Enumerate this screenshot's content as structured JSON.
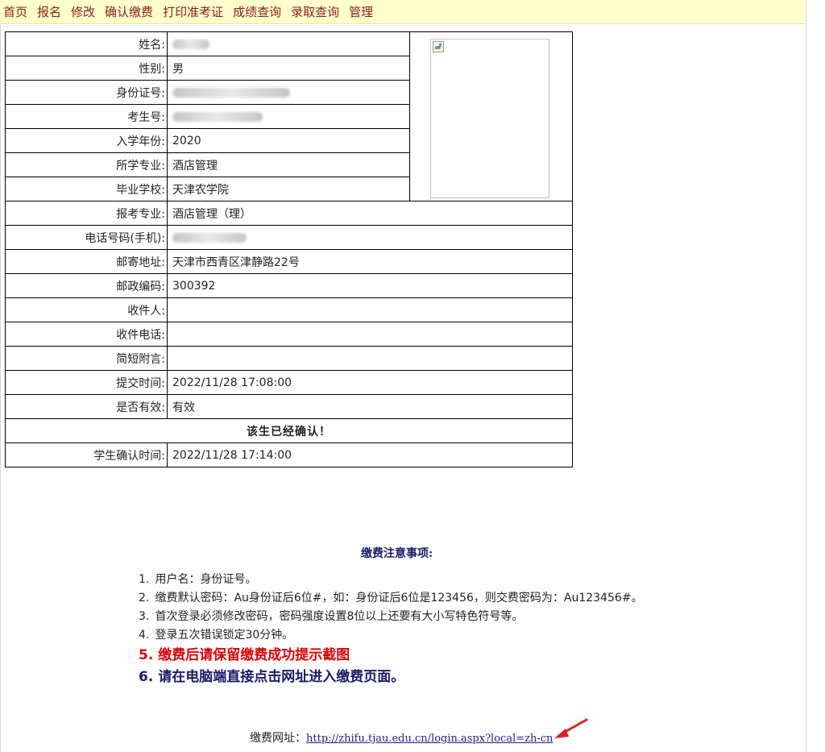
{
  "nav": {
    "items": [
      "首页",
      "报名",
      "修改",
      "确认缴费",
      "打印准考证",
      "成绩查询",
      "录取查询",
      "管理"
    ]
  },
  "info": {
    "name_label": "姓名:",
    "gender_label": "性别:",
    "gender": "男",
    "id_label": "身份证号:",
    "exam_no_label": "考生号:",
    "year_label": "入学年份:",
    "year": "2020",
    "major_label": "所学专业:",
    "major": "酒店管理",
    "school_label": "毕业学校:",
    "school": "天津农学院",
    "apply_major_label": "报考专业:",
    "apply_major": "酒店管理（理）",
    "phone_label": "电话号码(手机):",
    "address_label": "邮寄地址:",
    "address": "天津市西青区津静路22号",
    "postcode_label": "邮政编码:",
    "postcode": "300392",
    "recipient_label": "收件人:",
    "recipient": "",
    "recipient_phone_label": "收件电话:",
    "recipient_phone": "",
    "note_label": "简短附言:",
    "note": "",
    "submit_time_label": "提交时间:",
    "submit_time": "2022/11/28 17:08:00",
    "valid_label": "是否有效:",
    "valid": "有效",
    "confirmed_msg": "该生已经确认！",
    "confirm_time_label": "学生确认时间:",
    "confirm_time": "2022/11/28 17:14:00"
  },
  "notice": {
    "title": "缴费注意事项:",
    "items": [
      {
        "num": "1.",
        "text": "用户名：身份证号。"
      },
      {
        "num": "2.",
        "text": "缴费默认密码：Au身份证后6位#，如：身份证后6位是123456，则交费密码为：Au123456#。"
      },
      {
        "num": "3.",
        "text": "首次登录必须修改密码，密码强度设置8位以上还要有大小写特色符号等。"
      },
      {
        "num": "4.",
        "text": "登录五次错误锁定30分钟。"
      },
      {
        "num": "5.",
        "text": "缴费后请保留缴费成功提示截图"
      },
      {
        "num": "6.",
        "text": "请在电脑端直接点击网址进入缴费页面。"
      }
    ]
  },
  "pay": {
    "label": "缴费网址：",
    "url": "http://zhifu.tjau.edu.cn/login.aspx?local=zh-cn"
  },
  "colors": {
    "nav_bg": "#ffffcc",
    "nav_link": "#8a1c1c",
    "alert_red": "#e00000",
    "navy": "#1a1a6a",
    "arrow_red": "#e02020"
  }
}
